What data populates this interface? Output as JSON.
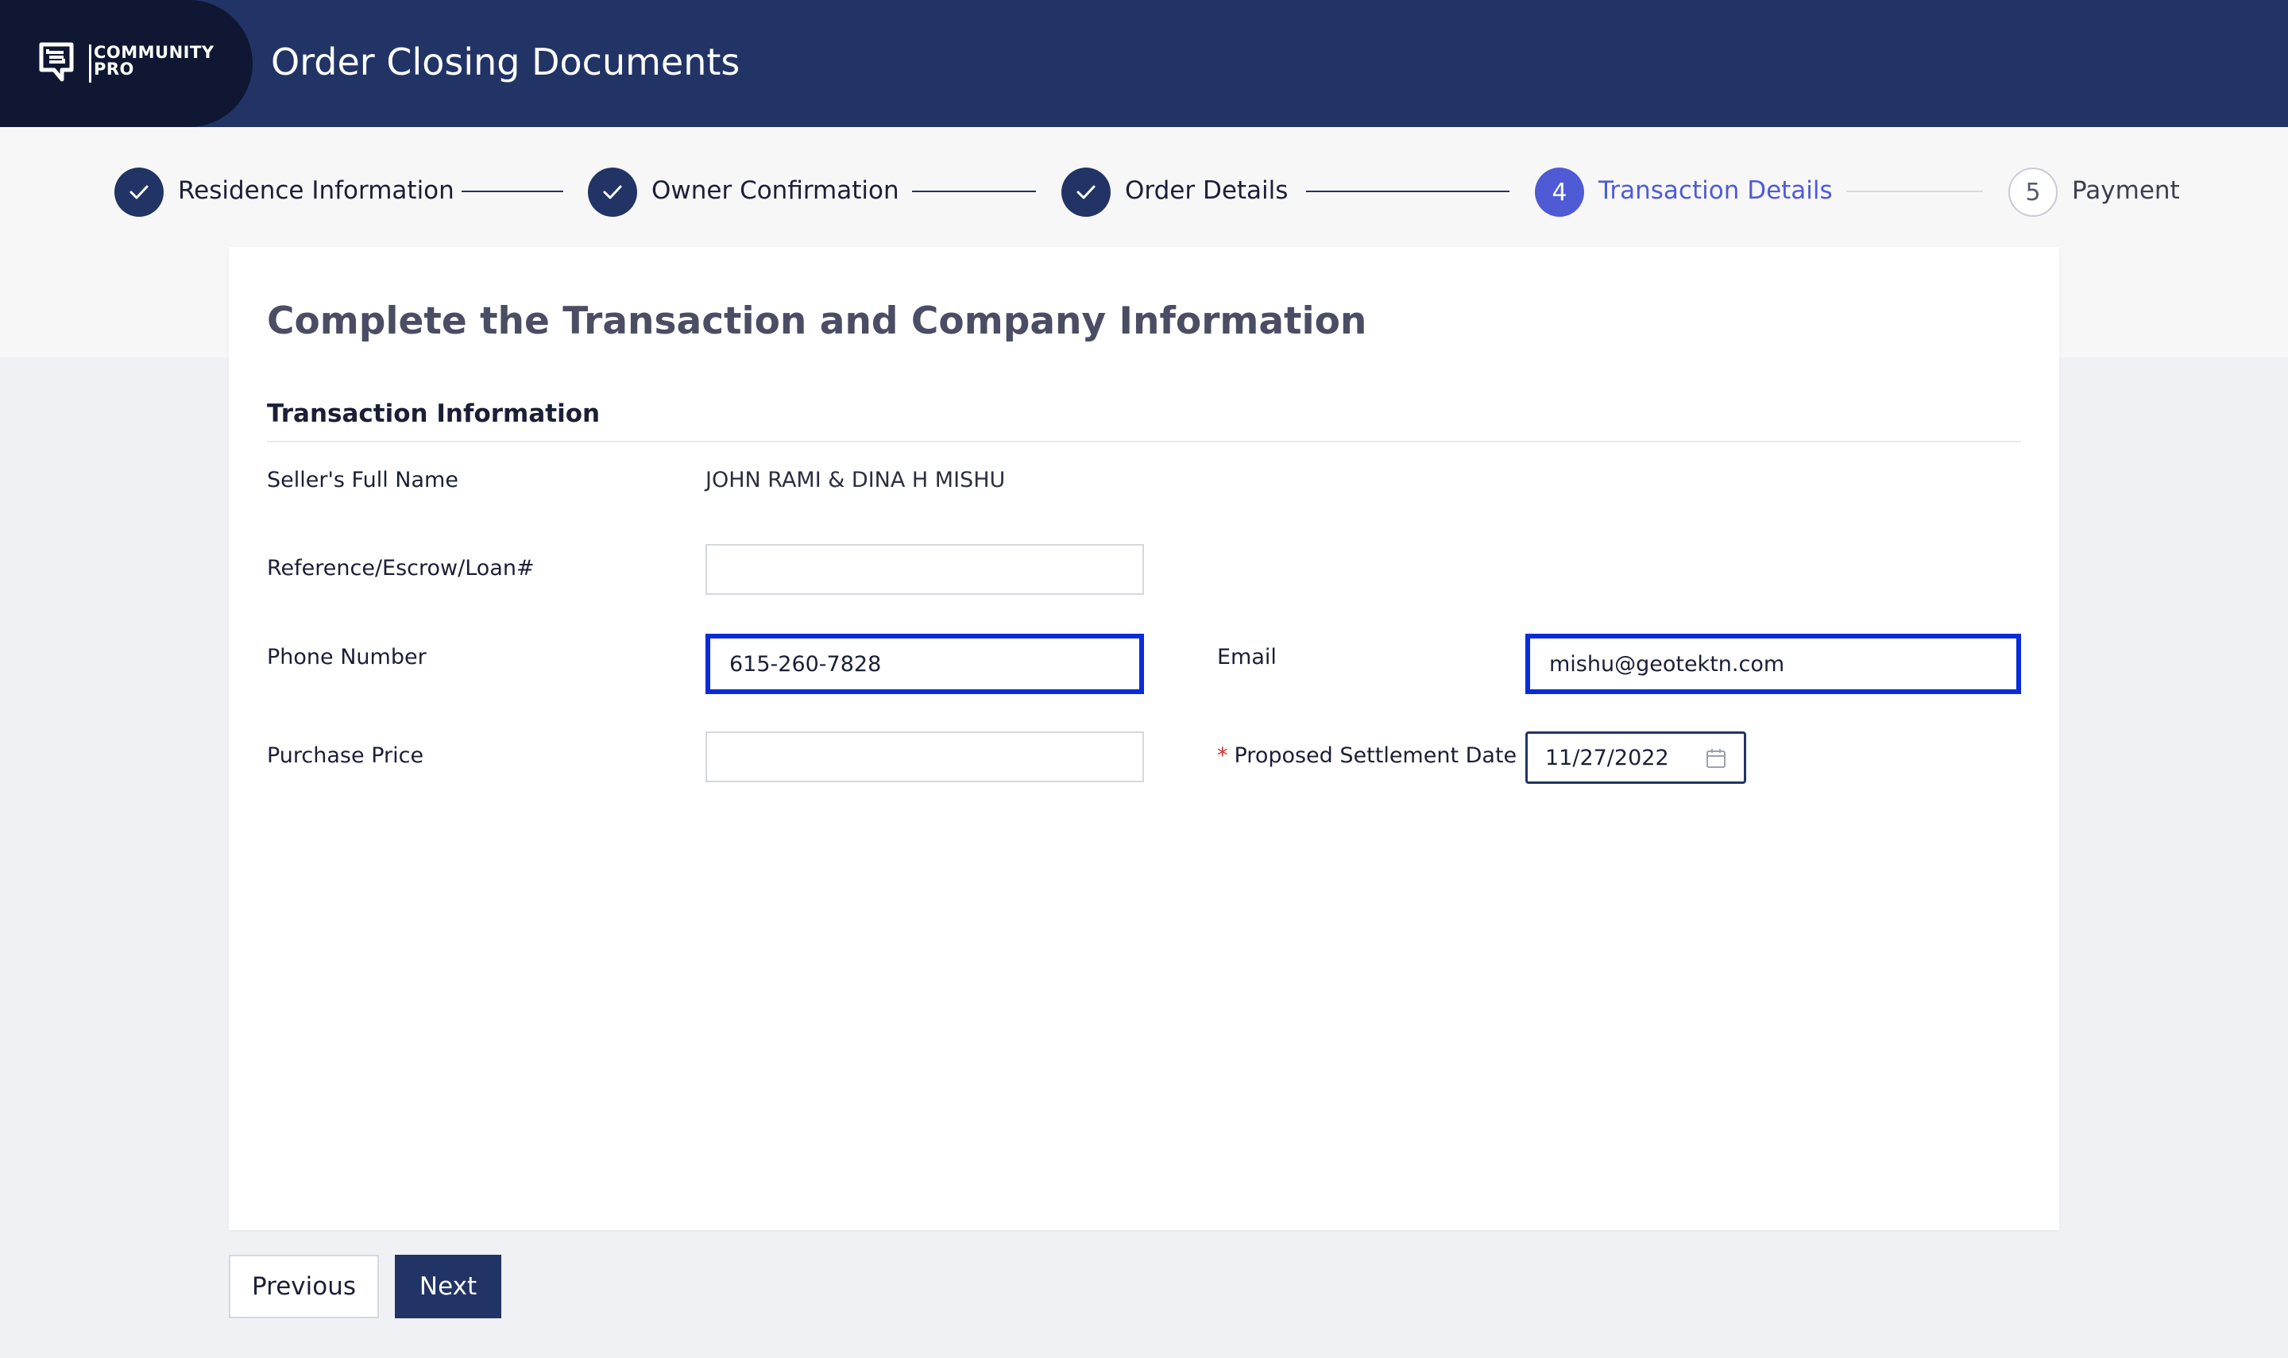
{
  "header": {
    "logo_line1": "COMMUNITY",
    "logo_line2": "PRO",
    "title": "Order Closing Documents"
  },
  "stepper": {
    "steps": [
      {
        "label": "Residence Information",
        "status": "complete",
        "icon": "check-icon"
      },
      {
        "label": "Owner Confirmation",
        "status": "complete",
        "icon": "check-icon"
      },
      {
        "label": "Order Details",
        "status": "complete",
        "icon": "check-icon"
      },
      {
        "number": "4",
        "label": "Transaction Details",
        "status": "current"
      },
      {
        "number": "5",
        "label": "Payment",
        "status": "upcoming"
      }
    ]
  },
  "form": {
    "title": "Complete the Transaction and Company Information",
    "section_title": "Transaction Information",
    "seller_label": "Seller's Full Name",
    "seller_value": "JOHN RAMI & DINA H MISHU",
    "reference_label": "Reference/Escrow/Loan#",
    "reference_value": "",
    "phone_label": "Phone Number",
    "phone_value": "615-260-7828",
    "email_label": "Email",
    "email_value": "mishu@geotektn.com",
    "price_label": "Purchase Price",
    "price_value": "",
    "settlement_required_mark": "*",
    "settlement_label": "Proposed Settlement Date",
    "settlement_value": "11/27/2022"
  },
  "buttons": {
    "previous": "Previous",
    "next": "Next"
  },
  "colors": {
    "header_bg": "#223465",
    "logo_bg": "#0f1733",
    "accent": "#4f5bd5",
    "focus_outline": "#0a2bd8",
    "required": "#d0312d"
  }
}
